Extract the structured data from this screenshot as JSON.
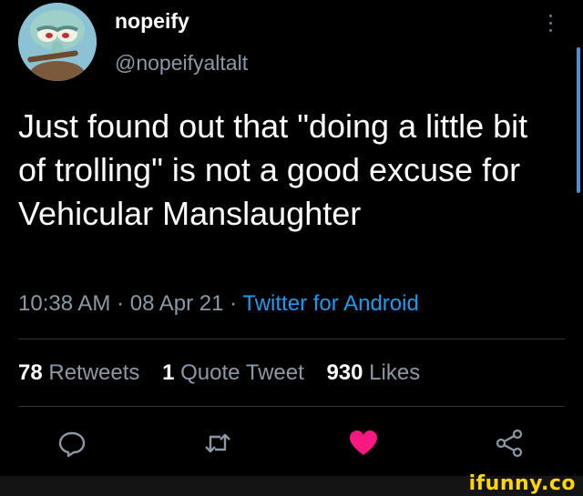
{
  "tweet": {
    "display_name": "nopeify",
    "handle": "@nopeifyaltalt",
    "text": "Just found out that \"doing a little bit of trolling\" is not a good excuse for Vehicular Manslaughter",
    "time": "10:38 AM",
    "date": "08 Apr 21",
    "separator": " · ",
    "source": "Twitter for Android"
  },
  "stats": {
    "retweets_count": "78",
    "retweets_label": "Retweets",
    "quotes_count": "1",
    "quotes_label": "Quote Tweet",
    "likes_count": "930",
    "likes_label": "Likes"
  },
  "actions": {
    "reply_icon": "reply-icon",
    "retweet_icon": "retweet-icon",
    "like_icon": "heart-icon",
    "share_icon": "share-icon",
    "like_color": "#f91880"
  },
  "colors": {
    "link": "#1d9bf0",
    "muted": "#8b98a5",
    "background": "#000000"
  },
  "watermark": "ifunny.co"
}
